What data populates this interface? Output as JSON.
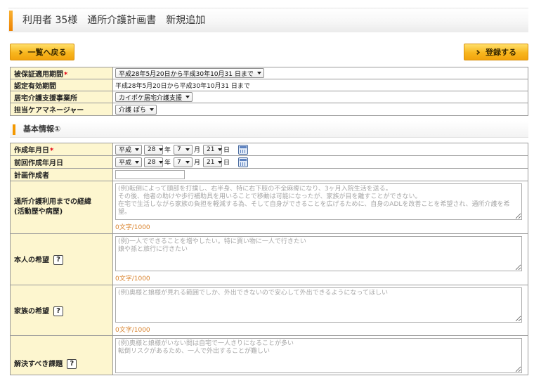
{
  "header": {
    "title": "利用者 35様　通所介護計画書　新規追加"
  },
  "actions": {
    "back_label": "一覧へ戻る",
    "register_label": "登録する"
  },
  "summary": {
    "insurance_period": {
      "label": "被保証適用期間",
      "required": "*",
      "value": "平成28年5月20日から平成30年10月31 日まで"
    },
    "certification_period": {
      "label": "認定有効期間",
      "value": "平成28年5月20日から平成30年10月31 日まで"
    },
    "care_office": {
      "label": "居宅介護支援事業所",
      "value": "カイポケ居宅介護支援"
    },
    "care_manager": {
      "label": "担当ケアマネージャー",
      "value": "介護 ぽち"
    }
  },
  "section": {
    "title": "基本情報①"
  },
  "form": {
    "help_glyph": "?",
    "created_date": {
      "label": "作成年月日",
      "required": "*",
      "era": "平成",
      "year": "28",
      "year_unit": "年",
      "month": "7",
      "month_unit": "月",
      "day": "21",
      "day_unit": "日"
    },
    "previous_date": {
      "label": "前回作成年月日",
      "era": "平成",
      "year": "28",
      "year_unit": "年",
      "month": "7",
      "month_unit": "月",
      "day": "21",
      "day_unit": "日"
    },
    "planner": {
      "label": "計画作成者"
    },
    "history": {
      "label_line1": "通所介護利用までの経緯",
      "label_line2": "(活動歴や病歴)",
      "placeholder": "(例)転倒によって頭部を打撲し、右半身、特に右下肢の不全麻痺になり、3ヶ月入院生活を送る。\nその後、他者の助けや歩行補助具を用いることで移動は可能になったが、家族が目を離すことができない。\n在宅で生活しながら家族の負担を軽減する為、そして自身ができることを広げるために、自身のADLを改善ことを希望され、通所介護を希望。",
      "counter": "0文字/1000"
    },
    "personal_wish": {
      "label": "本人の希望",
      "placeholder": "(例)一人でできることを増やしたい。特に買い物に一人で行きたい\n娘や孫と旅行に行きたい",
      "counter": "0文字/1000"
    },
    "family_wish": {
      "label": "家族の希望",
      "placeholder": "(例)奥様と娘様が見れる範囲でしか、外出できないので安心して外出できるようになってほしい",
      "counter": "0文字/1000"
    },
    "issues": {
      "label": "解決すべき課題",
      "placeholder": "(例)奥様と娘様がいない間は自宅で一人きりになることが多い\n転倒リスクがあるため、一人で外出することが難しい"
    }
  },
  "icons": {
    "button_chevron": "chevron-right-icon",
    "select_arrow": "chevron-down-icon",
    "date_picker": "calendar-icon",
    "help": "help-icon"
  },
  "colors": {
    "accent": "#f39800",
    "button": "#f8b61e",
    "label_bg": "#fdf6cf",
    "required": "#e60012",
    "counter": "#d9822b"
  }
}
